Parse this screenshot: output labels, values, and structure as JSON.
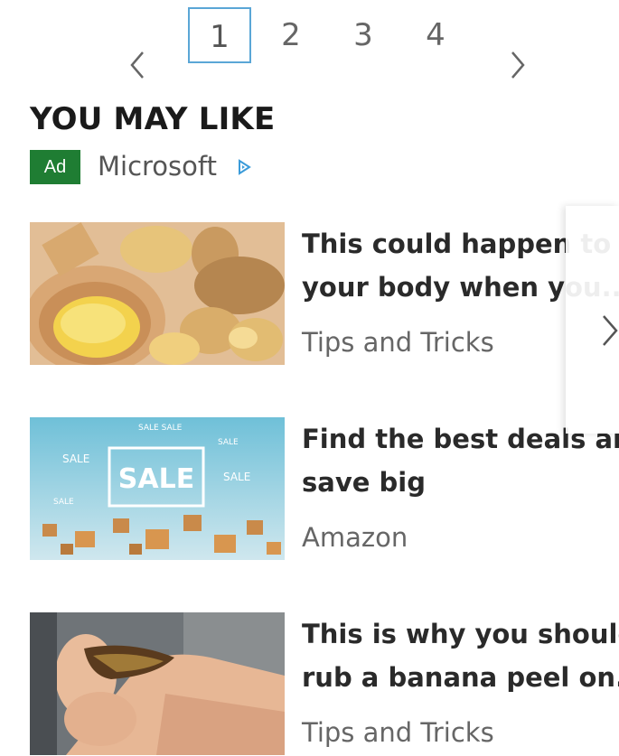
{
  "pagination": {
    "pages": [
      "1",
      "2",
      "3",
      "4"
    ],
    "active": "1",
    "prev_icon": "chevron-left-icon",
    "next_icon": "chevron-right-icon"
  },
  "section": {
    "title": "YOU MAY LIKE",
    "ad_badge": "Ad",
    "sponsor": "Microsoft",
    "adchoices_icon": "adchoices-play-icon",
    "badge_color": "#1f7d33"
  },
  "items": [
    {
      "title_line1": "This could happen to",
      "title_line2": "your body when you...",
      "source": "Tips and Tricks",
      "image": "ginger-root-on-wooden-spoon"
    },
    {
      "title_line1": "Find the best deals and",
      "title_line2": "save big",
      "source": "Amazon",
      "image": "sale-boxes-illustration"
    },
    {
      "title_line1": "This is why you should",
      "title_line2": "rub a banana peel on...",
      "source": "Tips and Tricks",
      "image": "hands-with-banana-peel"
    }
  ],
  "carousel": {
    "next_icon": "chevron-right-icon"
  }
}
